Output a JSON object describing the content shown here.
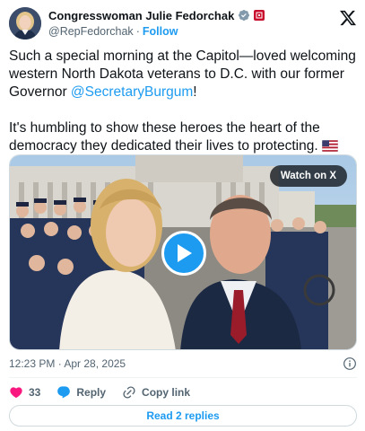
{
  "author": {
    "display_name": "Congresswoman Julie Fedorchak",
    "handle": "@RepFedorchak",
    "follow_label": "Follow",
    "separator": "·"
  },
  "tweet": {
    "paragraph1_before": "Such a special morning at the Capitol—loved welcoming western North Dakota veterans to D.C. with our former Governor ",
    "mention": "@SecretaryBurgum",
    "paragraph1_after": "!",
    "paragraph2": "It's humbling to show these heroes the heart of the democracy they dedicated their lives to protecting.",
    "flag_emoji": "🇺🇸"
  },
  "media": {
    "watch_label": "Watch on X"
  },
  "meta": {
    "timestamp": "12:23 PM · Apr 28, 2025"
  },
  "actions": {
    "like_count": "33",
    "reply_label": "Reply",
    "copy_label": "Copy link"
  },
  "replies_button": "Read 2 replies",
  "colors": {
    "accent": "#1d9bf0",
    "like": "#f91880",
    "text": "#0f1419",
    "muted": "#536471"
  },
  "icons": [
    "verified-badge-icon",
    "x-logo-icon",
    "play-icon",
    "info-icon",
    "heart-icon",
    "reply-bubble-icon",
    "link-icon"
  ]
}
